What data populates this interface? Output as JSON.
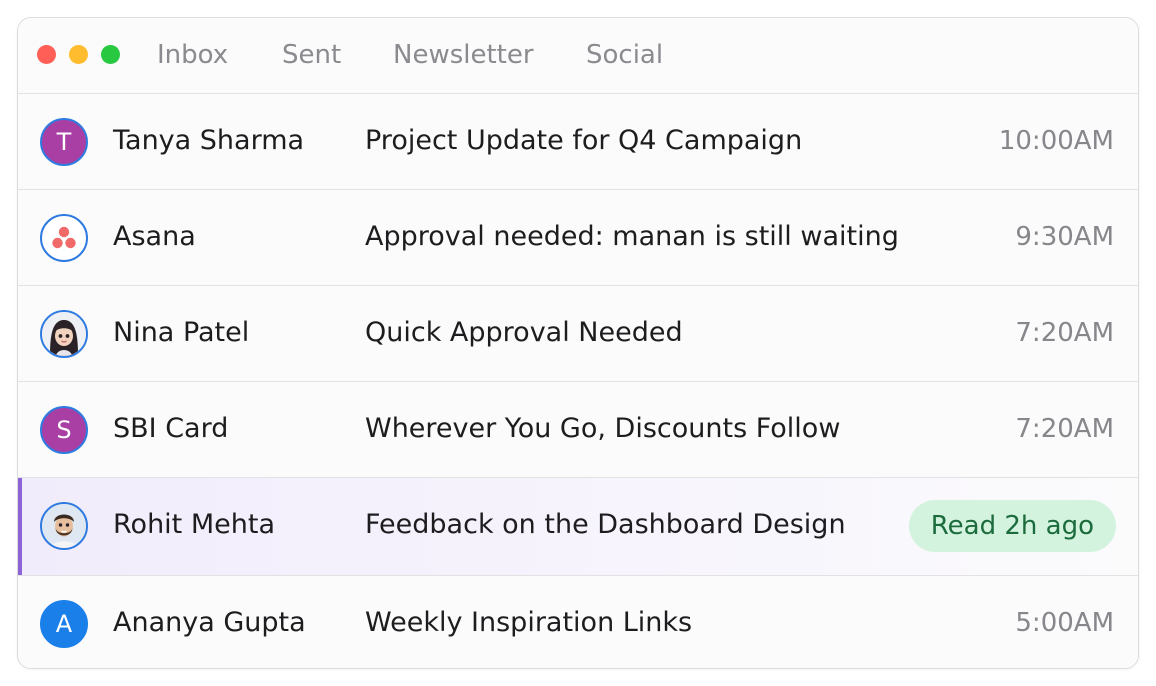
{
  "window_controls": [
    {
      "name": "close",
      "color": "#ff5f57"
    },
    {
      "name": "minimize",
      "color": "#febc2e"
    },
    {
      "name": "zoom",
      "color": "#28c840"
    }
  ],
  "tabs": [
    {
      "label": "Inbox"
    },
    {
      "label": "Sent"
    },
    {
      "label": "Newsletter"
    },
    {
      "label": "Social"
    }
  ],
  "emails": [
    {
      "avatar": {
        "type": "letter",
        "text": "T"
      },
      "sender": "Tanya Sharma",
      "subject": "Project Update for Q4 Campaign",
      "time": "10:00AM"
    },
    {
      "avatar": {
        "type": "icon",
        "icon": "asana-logo-icon"
      },
      "sender": "Asana",
      "subject": "Approval needed: manan is still waiting",
      "time": "9:30AM"
    },
    {
      "avatar": {
        "type": "image",
        "icon": "woman-portrait-icon"
      },
      "sender": "Nina Patel",
      "subject": "Quick Approval Needed",
      "time": "7:20AM"
    },
    {
      "avatar": {
        "type": "letter",
        "text": "S"
      },
      "sender": "SBI Card",
      "subject": "Wherever You Go, Discounts Follow",
      "time": "7:20AM"
    },
    {
      "avatar": {
        "type": "image",
        "icon": "man-portrait-icon"
      },
      "sender": "Rohit Mehta",
      "subject": "Feedback on the Dashboard Design",
      "status_badge": "Read 2h ago",
      "selected": true
    },
    {
      "avatar": {
        "type": "letter",
        "text": "A"
      },
      "sender": "Ananya Gupta",
      "subject": "Weekly Inspiration Links",
      "time": "5:00AM"
    }
  ],
  "colors": {
    "selected_accent": "#8b63d6",
    "badge_background": "#d3f3df",
    "badge_text": "#1c6b3d",
    "avatar_border": "#2f7be0",
    "letter_avatar_purple": "#a93ea4",
    "letter_avatar_blue": "#1a7fe8",
    "asana_coral": "#f06a6a"
  }
}
